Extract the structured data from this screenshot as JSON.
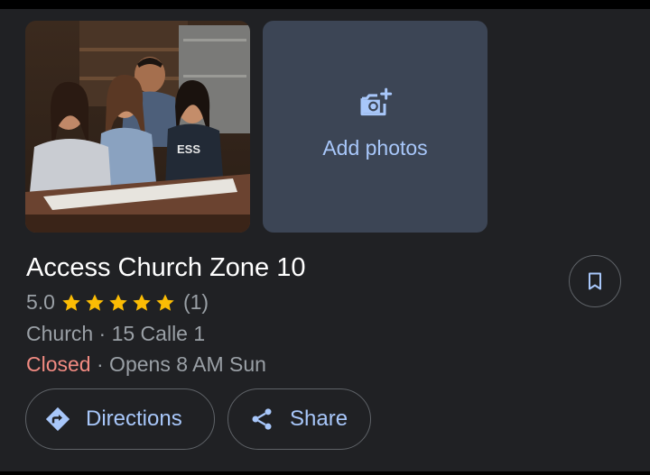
{
  "place": {
    "name": "Access Church Zone 10",
    "rating": "5.0",
    "stars": 5,
    "review_count": "(1)",
    "category_address": "Church · 15 Calle 1",
    "status": "Closed",
    "hours_note": "· Opens 8 AM Sun"
  },
  "photos": {
    "add_label": "Add photos",
    "shirt_text": "ESS"
  },
  "actions": {
    "directions_label": "Directions",
    "share_label": "Share"
  },
  "colors": {
    "background": "#202124",
    "accent": "#a8c7fa",
    "star": "#fbbc04",
    "closed": "#f28b82",
    "muted_text": "#9aa0a6",
    "add_photos_bg": "#3c4555"
  },
  "icons": {
    "add_photo": "add-photo-camera-icon",
    "bookmark": "bookmark-icon",
    "directions": "directions-icon",
    "share": "share-icon",
    "star": "star-icon"
  }
}
